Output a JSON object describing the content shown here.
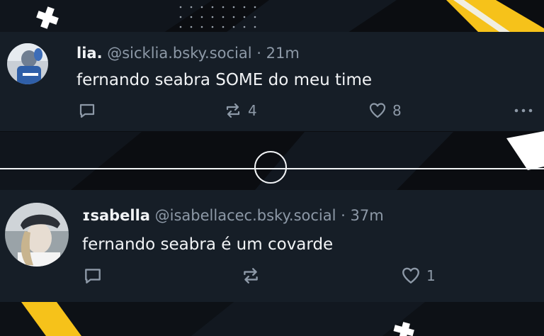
{
  "posts": [
    {
      "name": "lia.",
      "handle": "@sicklia.bsky.social",
      "separator": "·",
      "time": "21m",
      "text": "fernando seabra SOME do meu time",
      "reposts": "4",
      "likes": "8",
      "icons": [
        "reply-icon",
        "repost-icon",
        "like-icon",
        "more-icon"
      ]
    },
    {
      "name": "ɪsabella",
      "handle": "@isabellacec.bsky.social",
      "separator": "·",
      "time": "37m",
      "text": "fernando seabra é um covarde",
      "reposts": "",
      "likes": "1",
      "icons": [
        "reply-icon",
        "repost-icon",
        "like-icon"
      ]
    }
  ],
  "colors": {
    "card_bg": "#161e27",
    "muted_text": "#8d99a7",
    "primary_text": "#f1f3f5",
    "accent_yellow": "#f6c21a"
  }
}
